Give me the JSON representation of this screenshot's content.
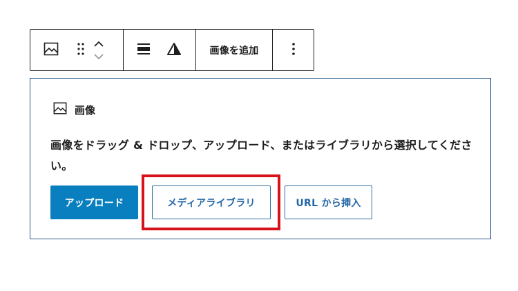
{
  "toolbar": {
    "add_image_label": "画像を追加",
    "icons": [
      "image-icon",
      "drag-handle-icon",
      "chevron-up-icon",
      "chevron-down-icon",
      "align-icon",
      "filter-icon",
      "more-options-icon"
    ]
  },
  "block": {
    "label": "画像",
    "instructions": "画像をドラッグ & ドロップ、アップロード、またはライブラリから選択してください。",
    "buttons": {
      "upload": "アップロード",
      "media_library": "メディアライブラリ",
      "insert_from_url": "URL から挿入"
    }
  },
  "colors": {
    "primary": "#0a7fc0",
    "border_focus": "#2c5b8f",
    "highlight": "#d8121b",
    "text": "#1e1e1e"
  }
}
